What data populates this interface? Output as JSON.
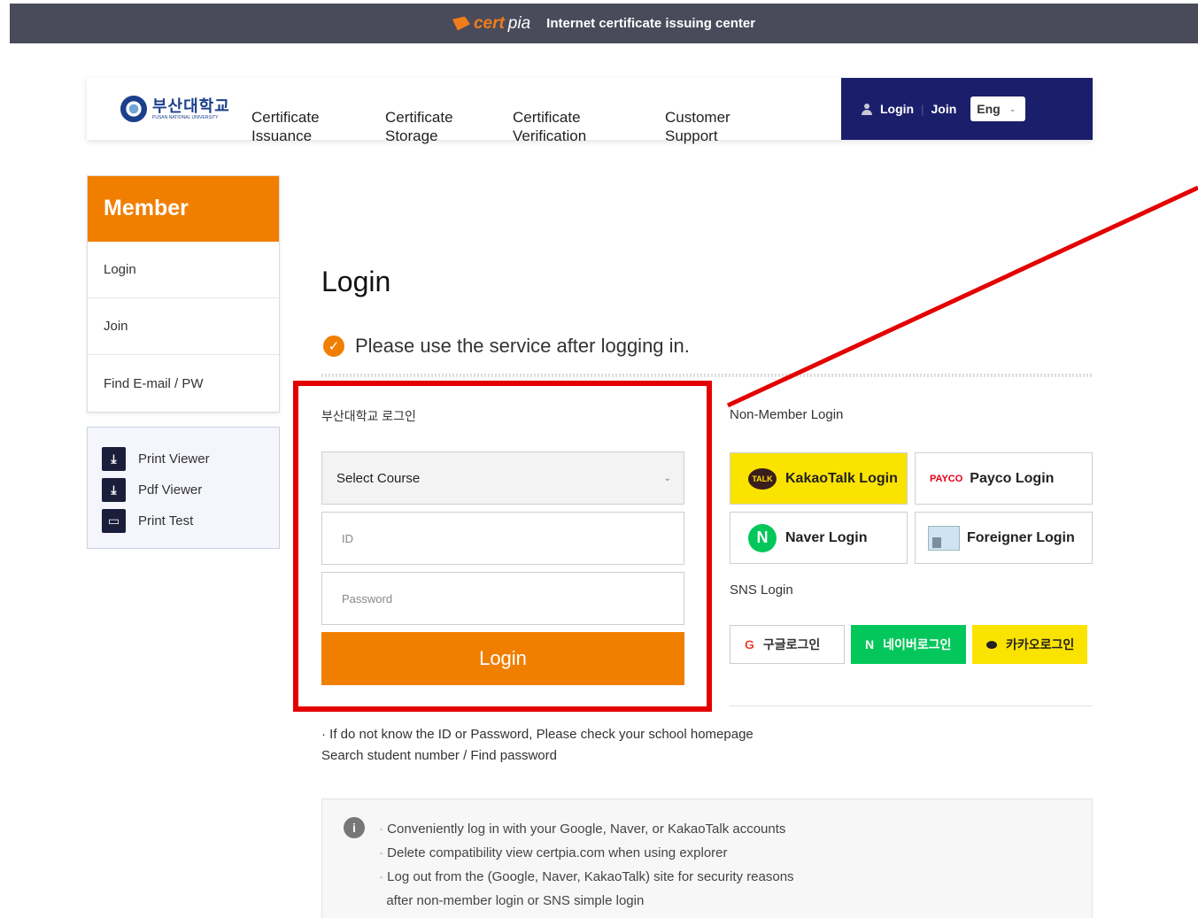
{
  "topbar": {
    "brand_cert": "cert",
    "brand_pia": "pia",
    "title": "Internet certificate issuing center"
  },
  "header": {
    "logo_ko": "부산대학교",
    "logo_en": "PUSAN NATIONAL UNIVERSITY",
    "nav": [
      {
        "line1": "Certificate",
        "line2": "Issuance"
      },
      {
        "line1": "Certificate",
        "line2": "Storage"
      },
      {
        "line1": "Certificate",
        "line2": "Verification"
      },
      {
        "line1": "Customer",
        "line2": "Support"
      }
    ],
    "login_label": "Login",
    "sep": "|",
    "join_label": "Join",
    "language": "Eng",
    "chev": "⌄"
  },
  "sidebar": {
    "title": "Member",
    "items": [
      {
        "label": "Login"
      },
      {
        "label": "Join"
      },
      {
        "label": "Find E-mail / PW"
      }
    ],
    "tools": [
      {
        "label": "Print Viewer",
        "icon": "download-icon"
      },
      {
        "label": "Pdf Viewer",
        "icon": "download-icon"
      },
      {
        "label": "Print Test",
        "icon": "printer-icon"
      }
    ]
  },
  "main": {
    "title": "Login",
    "notice": "Please use the service after logging in.",
    "login_label": "부산대학교 로그인",
    "course_select": "Select Course",
    "id_placeholder": "ID",
    "password_placeholder": "Password",
    "login_button": "Login",
    "nonmember_title": "Non-Member Login",
    "kakao_login": "KakaoTalk Login",
    "kakao_badge": "TALK",
    "payco_badge": "PAYCO",
    "payco_login": "Payco Login",
    "naver_badge": "N",
    "naver_login": "Naver Login",
    "foreigner_login": "Foreigner Login",
    "sns_title": "SNS Login",
    "sns_google": "구글로그인",
    "sns_google_badge": "G",
    "sns_naver": "네이버로그인",
    "sns_naver_badge": "N",
    "sns_kakao": "카카오로그인",
    "help_line1": "· If do not know the ID or Password, Please check your school homepage",
    "help_line2": "Search student number / Find password",
    "info_lines": [
      "Conveniently log in with your Google, Naver, or KakaoTalk accounts",
      "Delete compatibility view certpia.com when using explorer",
      "Log out from the (Google, Naver, KakaoTalk) site for security reasons",
      "after non-member login or SNS simple login"
    ]
  },
  "colors": {
    "accent": "#f07f00",
    "header_dark": "#1b1e6b",
    "topbar": "#4a4b5a",
    "highlight": "#e30000",
    "kakao": "#fbe300",
    "naver": "#03c75a"
  }
}
